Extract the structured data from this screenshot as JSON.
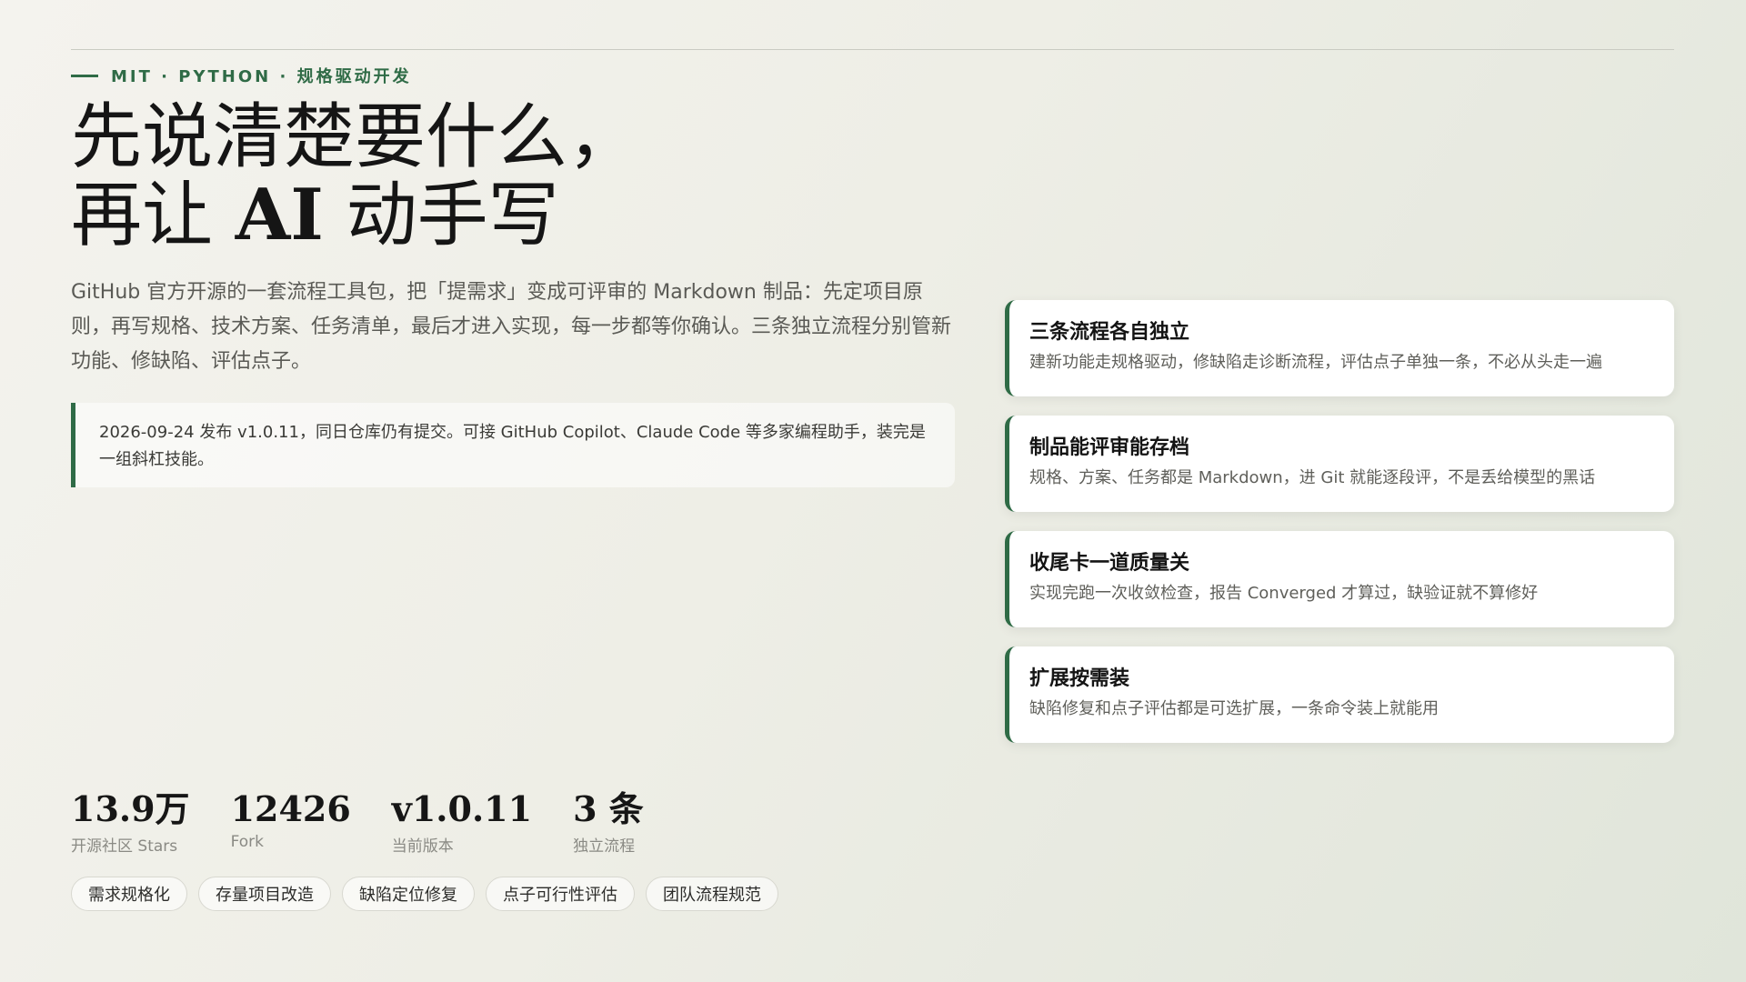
{
  "eyebrow": {
    "text": "MIT · PYTHON · 规格驱动开发"
  },
  "headline": {
    "line1": "先说清楚要什么，",
    "line2_prefix": "再让 ",
    "line2_ai": "AI",
    "line2_suffix": " 动手写"
  },
  "intro": "GitHub 官方开源的一套流程工具包，把「提需求」变成可评审的 Markdown 制品：先定项目原则，再写规格、技术方案、任务清单，最后才进入实现，每一步都等你确认。三条独立流程分别管新功能、修缺陷、评估点子。",
  "notice": "2026-09-24 发布 v1.0.11，同日仓库仍有提交。可接 GitHub Copilot、Claude Code 等多家编程助手，装完是一组斜杠技能。",
  "features": [
    {
      "title": "三条流程各自独立",
      "desc": "建新功能走规格驱动，修缺陷走诊断流程，评估点子单独一条，不必从头走一遍"
    },
    {
      "title": "制品能评审能存档",
      "desc": "规格、方案、任务都是 Markdown，进 Git 就能逐段评，不是丢给模型的黑话"
    },
    {
      "title": "收尾卡一道质量关",
      "desc": "实现完跑一次收敛检查，报告 Converged 才算过，缺验证就不算修好"
    },
    {
      "title": "扩展按需装",
      "desc": "缺陷修复和点子评估都是可选扩展，一条命令装上就能用"
    }
  ],
  "stats": [
    {
      "value": "13.9万",
      "label": "开源社区 Stars"
    },
    {
      "value": "12426",
      "label": "Fork"
    },
    {
      "value": "v1.0.11",
      "label": "当前版本"
    },
    {
      "value": "3 条",
      "label": "独立流程"
    }
  ],
  "tags": [
    "需求规格化",
    "存量项目改造",
    "缺陷定位修复",
    "点子可行性评估",
    "团队流程规范"
  ],
  "colors": {
    "accent": "#2f6b46"
  }
}
